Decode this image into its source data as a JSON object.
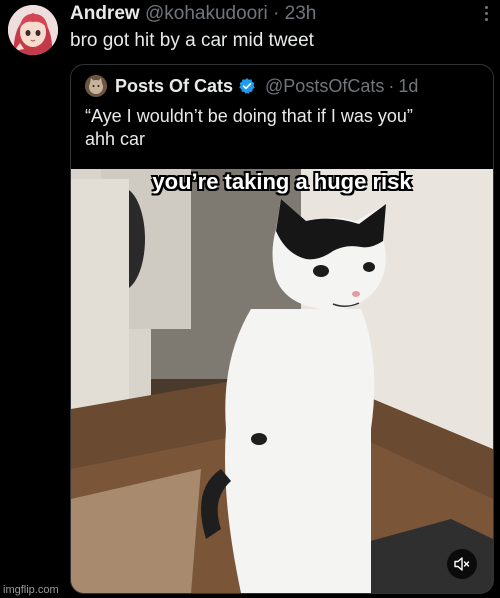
{
  "tweet": {
    "author_name": "Andrew",
    "author_handle": "@kohakudoori",
    "separator": "·",
    "time": "23h",
    "text": "bro got hit by a car mid tweet",
    "avatar_icon": "anime-avatar-icon",
    "more_icon": "more-dots-icon"
  },
  "quote": {
    "author_name": "Posts Of Cats",
    "author_handle": "@PostsOfCats",
    "separator": "·",
    "time": "1d",
    "verified_icon": "verified-badge-icon",
    "verified_color": "#1d9bf0",
    "text_line1": "“Aye I wouldn’t be doing that if I was you”",
    "text_line2": "ahh car",
    "media": {
      "caption": "you’re taking a huge risk",
      "mute_icon": "speaker-muted-icon"
    }
  },
  "watermark": "imgflip.com"
}
